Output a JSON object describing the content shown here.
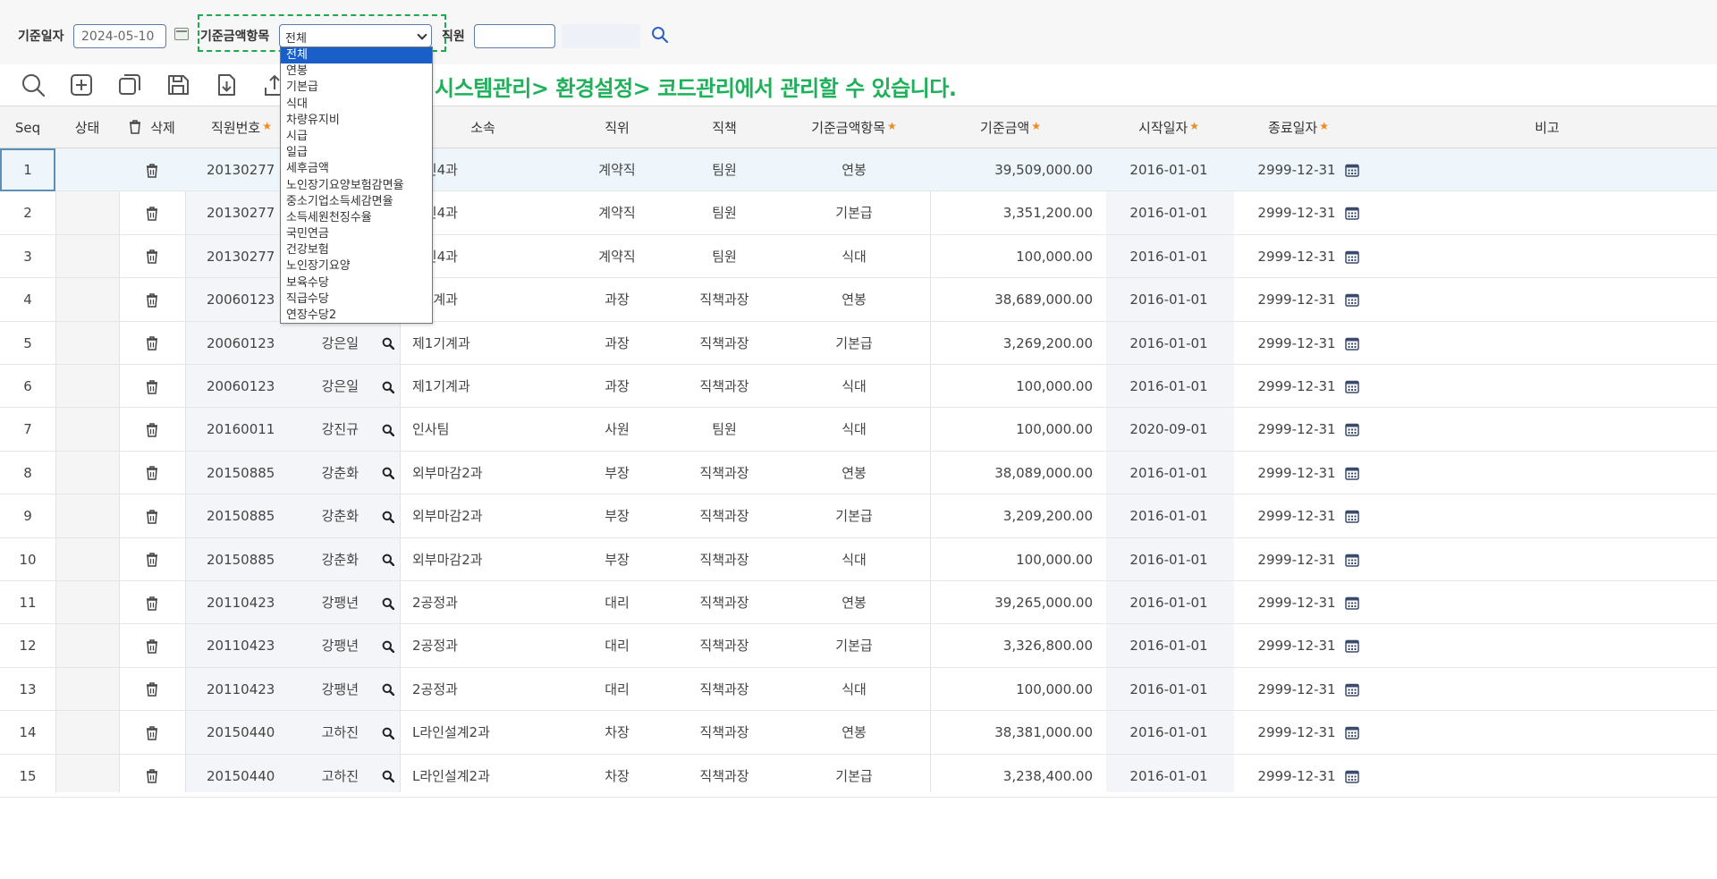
{
  "filters": {
    "base_date_label": "기준일자",
    "base_date_value": "2024-05-10",
    "amount_item_label": "기준금액항목",
    "amount_item_selected": "전체",
    "employee_label": "직원"
  },
  "dropdown": {
    "options": [
      "전체",
      "연봉",
      "기본급",
      "식대",
      "차량유지비",
      "시급",
      "일급",
      "세후금액",
      "노인장기요양보험감면율",
      "중소기업소득세감면율",
      "소득세원천징수율",
      "국민연금",
      "건강보험",
      "노인장기요양",
      "보육수당",
      "직급수당",
      "연장수당2"
    ],
    "selected_index": 0
  },
  "toolbar": {
    "icons": [
      "search-icon",
      "add-icon",
      "copy-icon",
      "save-icon",
      "download-icon",
      "upload-icon"
    ]
  },
  "notice": "시스템관리> 환경설정> 코드관리에서 관리할 수 있습니다.",
  "columns": {
    "seq": "Seq",
    "status": "상태",
    "delete": "삭제",
    "employee_no": "직원번호",
    "department": "소속",
    "position": "직위",
    "duty": "직책",
    "amount_item": "기준금액항목",
    "amount": "기준금액",
    "start_date": "시작일자",
    "end_date": "종료일자",
    "note": "비고"
  },
  "required_columns": [
    "employee_no",
    "amount_item",
    "amount",
    "start_date",
    "end_date"
  ],
  "rows": [
    {
      "seq": "1",
      "emp": "20130277",
      "name": "",
      "dept": "라인4과",
      "pos": "계약직",
      "duty": "팀원",
      "item": "연봉",
      "amount": "39,509,000.00",
      "start": "2016-01-01",
      "end": "2999-12-31"
    },
    {
      "seq": "2",
      "emp": "20130277",
      "name": "",
      "dept": "라인4과",
      "pos": "계약직",
      "duty": "팀원",
      "item": "기본급",
      "amount": "3,351,200.00",
      "start": "2016-01-01",
      "end": "2999-12-31"
    },
    {
      "seq": "3",
      "emp": "20130277",
      "name": "",
      "dept": "라인4과",
      "pos": "계약직",
      "duty": "팀원",
      "item": "식대",
      "amount": "100,000.00",
      "start": "2016-01-01",
      "end": "2999-12-31"
    },
    {
      "seq": "4",
      "emp": "20060123",
      "name": "",
      "dept": "1기계과",
      "pos": "과장",
      "duty": "직책과장",
      "item": "연봉",
      "amount": "38,689,000.00",
      "start": "2016-01-01",
      "end": "2999-12-31"
    },
    {
      "seq": "5",
      "emp": "20060123",
      "name": "강은일",
      "dept": "제1기계과",
      "pos": "과장",
      "duty": "직책과장",
      "item": "기본급",
      "amount": "3,269,200.00",
      "start": "2016-01-01",
      "end": "2999-12-31"
    },
    {
      "seq": "6",
      "emp": "20060123",
      "name": "강은일",
      "dept": "제1기계과",
      "pos": "과장",
      "duty": "직책과장",
      "item": "식대",
      "amount": "100,000.00",
      "start": "2016-01-01",
      "end": "2999-12-31"
    },
    {
      "seq": "7",
      "emp": "20160011",
      "name": "강진규",
      "dept": "인사팀",
      "pos": "사원",
      "duty": "팀원",
      "item": "식대",
      "amount": "100,000.00",
      "start": "2020-09-01",
      "end": "2999-12-31"
    },
    {
      "seq": "8",
      "emp": "20150885",
      "name": "강춘화",
      "dept": "외부마감2과",
      "pos": "부장",
      "duty": "직책과장",
      "item": "연봉",
      "amount": "38,089,000.00",
      "start": "2016-01-01",
      "end": "2999-12-31"
    },
    {
      "seq": "9",
      "emp": "20150885",
      "name": "강춘화",
      "dept": "외부마감2과",
      "pos": "부장",
      "duty": "직책과장",
      "item": "기본급",
      "amount": "3,209,200.00",
      "start": "2016-01-01",
      "end": "2999-12-31"
    },
    {
      "seq": "10",
      "emp": "20150885",
      "name": "강춘화",
      "dept": "외부마감2과",
      "pos": "부장",
      "duty": "직책과장",
      "item": "식대",
      "amount": "100,000.00",
      "start": "2016-01-01",
      "end": "2999-12-31"
    },
    {
      "seq": "11",
      "emp": "20110423",
      "name": "강팽년",
      "dept": "2공정과",
      "pos": "대리",
      "duty": "직책과장",
      "item": "연봉",
      "amount": "39,265,000.00",
      "start": "2016-01-01",
      "end": "2999-12-31"
    },
    {
      "seq": "12",
      "emp": "20110423",
      "name": "강팽년",
      "dept": "2공정과",
      "pos": "대리",
      "duty": "직책과장",
      "item": "기본급",
      "amount": "3,326,800.00",
      "start": "2016-01-01",
      "end": "2999-12-31"
    },
    {
      "seq": "13",
      "emp": "20110423",
      "name": "강팽년",
      "dept": "2공정과",
      "pos": "대리",
      "duty": "직책과장",
      "item": "식대",
      "amount": "100,000.00",
      "start": "2016-01-01",
      "end": "2999-12-31"
    },
    {
      "seq": "14",
      "emp": "20150440",
      "name": "고하진",
      "dept": "L라인설계2과",
      "pos": "차장",
      "duty": "직책과장",
      "item": "연봉",
      "amount": "38,381,000.00",
      "start": "2016-01-01",
      "end": "2999-12-31"
    },
    {
      "seq": "15",
      "emp": "20150440",
      "name": "고하진",
      "dept": "L라인설계2과",
      "pos": "차장",
      "duty": "직책과장",
      "item": "기본급",
      "amount": "3,238,400.00",
      "start": "2016-01-01",
      "end": "2999-12-31"
    }
  ],
  "colors": {
    "accent": "#1a5fc8",
    "notice": "#1fb15a",
    "required": "#f08a1c",
    "highlight": "#1fa84f"
  }
}
